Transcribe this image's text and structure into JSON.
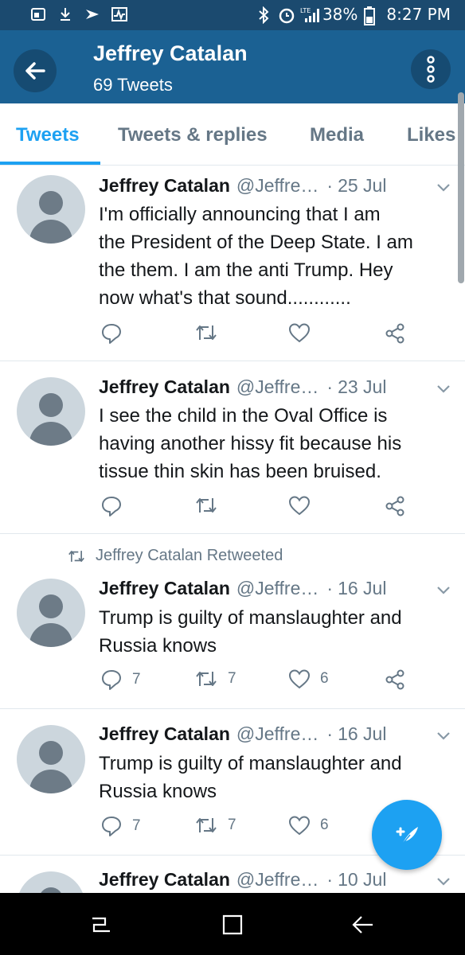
{
  "status_bar": {
    "battery": "38%",
    "time": "8:27 PM",
    "network": "LTE",
    "icons": [
      "gallery-icon",
      "download-icon",
      "sprint-icon",
      "activity-icon",
      "bluetooth-icon",
      "alarm-icon",
      "signal-icon",
      "battery-icon"
    ]
  },
  "header": {
    "title": "Jeffrey Catalan",
    "subtitle": "69 Tweets"
  },
  "tabs": [
    {
      "label": "Tweets",
      "active": true
    },
    {
      "label": "Tweets & replies",
      "active": false
    },
    {
      "label": "Media",
      "active": false
    },
    {
      "label": "Likes",
      "active": false
    }
  ],
  "tweets": [
    {
      "name": "Jeffrey Catalan",
      "handle": "@Jeffre…",
      "date": "25 Jul",
      "text_lines": [
        "I'm officially announcing that I am",
        "the President of the Deep State. I am",
        "the them. I am the anti Trump. Hey",
        "now what's that sound............"
      ],
      "replies": "",
      "retweets": "",
      "likes": ""
    },
    {
      "name": "Jeffrey Catalan",
      "handle": "@Jeffre…",
      "date": "23 Jul",
      "text_lines": [
        "I see the child in the Oval Office is",
        "having another hissy fit because his",
        "tissue thin skin has been bruised."
      ],
      "replies": "",
      "retweets": "",
      "likes": ""
    },
    {
      "retweeted_by": "Jeffrey Catalan Retweeted",
      "name": "Jeffrey Catalan",
      "handle": "@Jeffre…",
      "date": "16 Jul",
      "text_lines": [
        "Trump is guilty of manslaughter and",
        "Russia knows"
      ],
      "replies": "7",
      "retweets": "7",
      "likes": "6"
    },
    {
      "name": "Jeffrey Catalan",
      "handle": "@Jeffre…",
      "date": "16 Jul",
      "text_lines": [
        "Trump is guilty of manslaughter and",
        "Russia knows"
      ],
      "replies": "7",
      "retweets": "7",
      "likes": "6"
    },
    {
      "name": "Jeffrey Catalan",
      "handle": "@Jeffre…",
      "date": "10 Jul"
    }
  ],
  "colors": {
    "status_bar": "#1b4a6f",
    "app_bar": "#1b6193",
    "accent": "#1da1f2",
    "muted": "#657786",
    "text": "#14171a"
  }
}
